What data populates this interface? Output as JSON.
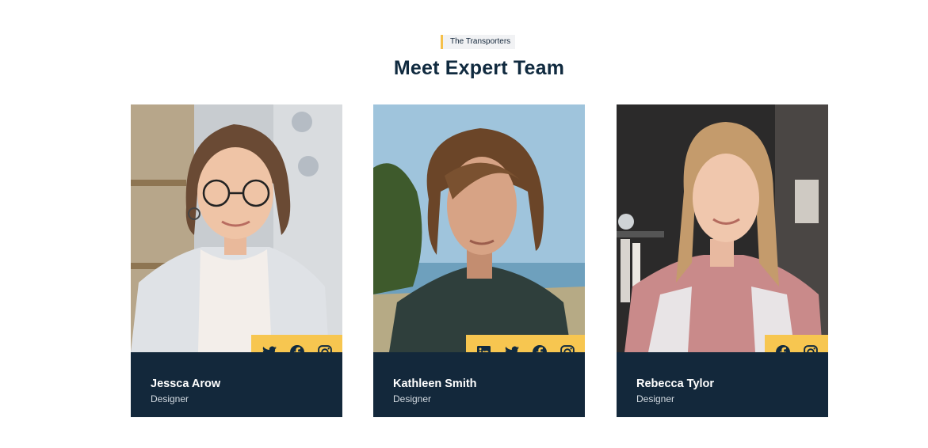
{
  "section": {
    "tagline": "The Transporters",
    "title": "Meet Expert Team"
  },
  "team": [
    {
      "name": "Jessca Arow",
      "role": "Designer",
      "social": [
        "twitter-icon",
        "facebook-icon",
        "instagram-icon"
      ]
    },
    {
      "name": "Kathleen Smith",
      "role": "Designer",
      "social": [
        "linkedin-icon",
        "twitter-icon",
        "facebook-icon",
        "instagram-icon"
      ]
    },
    {
      "name": "Rebecca Tylor",
      "role": "Designer",
      "social": [
        "facebook-icon",
        "instagram-icon"
      ]
    }
  ],
  "colors": {
    "accent": "#f7c650",
    "dark_panel": "#13283b",
    "heading": "#102a3f"
  }
}
